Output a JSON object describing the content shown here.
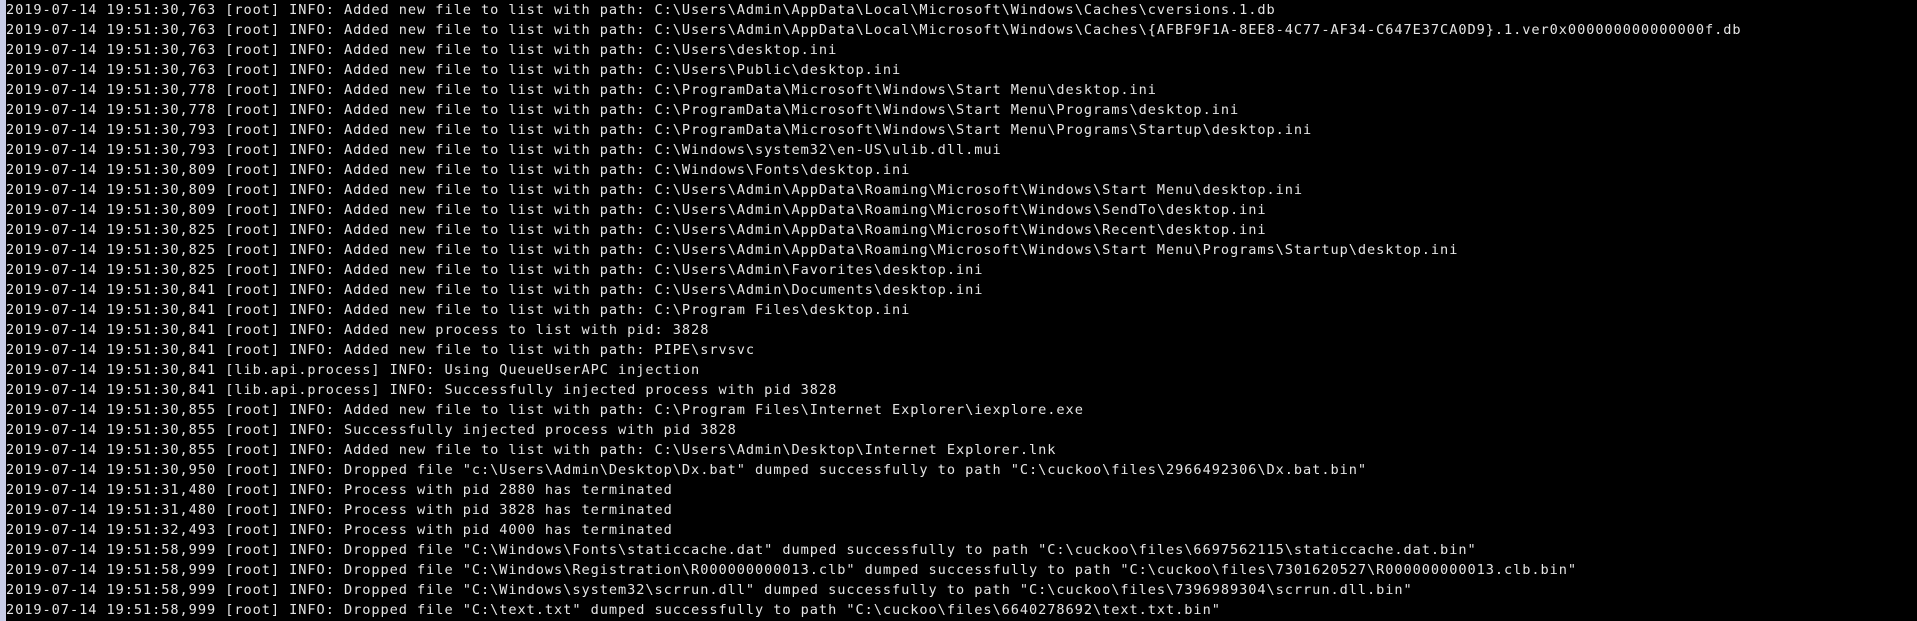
{
  "console": {
    "colors": {
      "background": "#000000",
      "text": "#e6e6e6",
      "left_edge": "#c8cde8"
    },
    "lines": [
      "2019-07-14 19:51:30,763 [root] INFO: Added new file to list with path: C:\\Users\\Admin\\AppData\\Local\\Microsoft\\Windows\\Caches\\cversions.1.db",
      "2019-07-14 19:51:30,763 [root] INFO: Added new file to list with path: C:\\Users\\Admin\\AppData\\Local\\Microsoft\\Windows\\Caches\\{AFBF9F1A-8EE8-4C77-AF34-C647E37CA0D9}.1.ver0x000000000000000f.db",
      "2019-07-14 19:51:30,763 [root] INFO: Added new file to list with path: C:\\Users\\desktop.ini",
      "2019-07-14 19:51:30,763 [root] INFO: Added new file to list with path: C:\\Users\\Public\\desktop.ini",
      "2019-07-14 19:51:30,778 [root] INFO: Added new file to list with path: C:\\ProgramData\\Microsoft\\Windows\\Start Menu\\desktop.ini",
      "2019-07-14 19:51:30,778 [root] INFO: Added new file to list with path: C:\\ProgramData\\Microsoft\\Windows\\Start Menu\\Programs\\desktop.ini",
      "2019-07-14 19:51:30,793 [root] INFO: Added new file to list with path: C:\\ProgramData\\Microsoft\\Windows\\Start Menu\\Programs\\Startup\\desktop.ini",
      "2019-07-14 19:51:30,793 [root] INFO: Added new file to list with path: C:\\Windows\\system32\\en-US\\ulib.dll.mui",
      "2019-07-14 19:51:30,809 [root] INFO: Added new file to list with path: C:\\Windows\\Fonts\\desktop.ini",
      "2019-07-14 19:51:30,809 [root] INFO: Added new file to list with path: C:\\Users\\Admin\\AppData\\Roaming\\Microsoft\\Windows\\Start Menu\\desktop.ini",
      "2019-07-14 19:51:30,809 [root] INFO: Added new file to list with path: C:\\Users\\Admin\\AppData\\Roaming\\Microsoft\\Windows\\SendTo\\desktop.ini",
      "2019-07-14 19:51:30,825 [root] INFO: Added new file to list with path: C:\\Users\\Admin\\AppData\\Roaming\\Microsoft\\Windows\\Recent\\desktop.ini",
      "2019-07-14 19:51:30,825 [root] INFO: Added new file to list with path: C:\\Users\\Admin\\AppData\\Roaming\\Microsoft\\Windows\\Start Menu\\Programs\\Startup\\desktop.ini",
      "2019-07-14 19:51:30,825 [root] INFO: Added new file to list with path: C:\\Users\\Admin\\Favorites\\desktop.ini",
      "2019-07-14 19:51:30,841 [root] INFO: Added new file to list with path: C:\\Users\\Admin\\Documents\\desktop.ini",
      "2019-07-14 19:51:30,841 [root] INFO: Added new file to list with path: C:\\Program Files\\desktop.ini",
      "2019-07-14 19:51:30,841 [root] INFO: Added new process to list with pid: 3828",
      "2019-07-14 19:51:30,841 [root] INFO: Added new file to list with path: PIPE\\srvsvc",
      "2019-07-14 19:51:30,841 [lib.api.process] INFO: Using QueueUserAPC injection",
      "2019-07-14 19:51:30,841 [lib.api.process] INFO: Successfully injected process with pid 3828",
      "2019-07-14 19:51:30,855 [root] INFO: Added new file to list with path: C:\\Program Files\\Internet Explorer\\iexplore.exe",
      "2019-07-14 19:51:30,855 [root] INFO: Successfully injected process with pid 3828",
      "2019-07-14 19:51:30,855 [root] INFO: Added new file to list with path: C:\\Users\\Admin\\Desktop\\Internet Explorer.lnk",
      "2019-07-14 19:51:30,950 [root] INFO: Dropped file \"c:\\Users\\Admin\\Desktop\\Dx.bat\" dumped successfully to path \"C:\\cuckoo\\files\\2966492306\\Dx.bat.bin\"",
      "2019-07-14 19:51:31,480 [root] INFO: Process with pid 2880 has terminated",
      "2019-07-14 19:51:31,480 [root] INFO: Process with pid 3828 has terminated",
      "2019-07-14 19:51:32,493 [root] INFO: Process with pid 4000 has terminated",
      "2019-07-14 19:51:58,999 [root] INFO: Dropped file \"C:\\Windows\\Fonts\\staticcache.dat\" dumped successfully to path \"C:\\cuckoo\\files\\6697562115\\staticcache.dat.bin\"",
      "2019-07-14 19:51:58,999 [root] INFO: Dropped file \"C:\\Windows\\Registration\\R000000000013.clb\" dumped successfully to path \"C:\\cuckoo\\files\\7301620527\\R000000000013.clb.bin\"",
      "2019-07-14 19:51:58,999 [root] INFO: Dropped file \"C:\\Windows\\system32\\scrrun.dll\" dumped successfully to path \"C:\\cuckoo\\files\\7396989304\\scrrun.dll.bin\"",
      "2019-07-14 19:51:58,999 [root] INFO: Dropped file \"C:\\text.txt\" dumped successfully to path \"C:\\cuckoo\\files\\6640278692\\text.txt.bin\""
    ]
  }
}
